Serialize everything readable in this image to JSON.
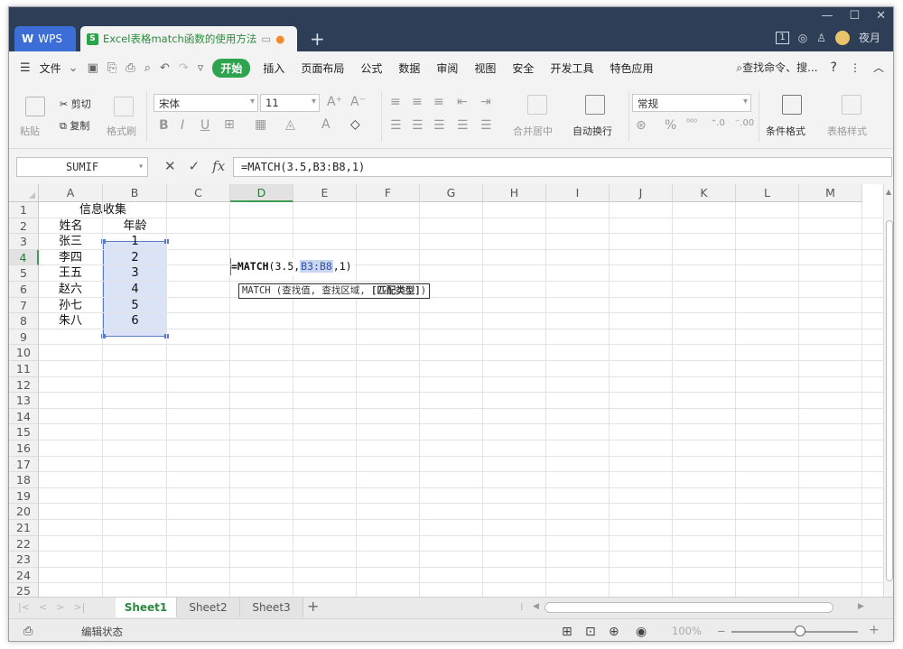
{
  "titlebar": {
    "app_tab": "WPS",
    "doc_tab": "Excel表格match函数的使用方法",
    "new_tab": "+",
    "badge": "1",
    "user": "夜月"
  },
  "menu": {
    "file": "文件",
    "start": "开始",
    "items": [
      "插入",
      "页面布局",
      "公式",
      "数据",
      "审阅",
      "视图",
      "安全",
      "开发工具",
      "特色应用"
    ],
    "search": "查找命令、搜...",
    "help": "?"
  },
  "ribbon": {
    "paste": "粘贴",
    "cut": "剪切",
    "copy": "复制",
    "format_painter": "格式刷",
    "font_name": "宋体",
    "font_size": "11",
    "merge": "合并居中",
    "wrap": "自动换行",
    "number_format": "常规",
    "cond_format": "条件格式",
    "table_style": "表格样式"
  },
  "formula_bar": {
    "name_box": "SUMIF",
    "formula": "=MATCH(3.5,B3:B8,1)"
  },
  "grid": {
    "columns": [
      "A",
      "B",
      "C",
      "D",
      "E",
      "F",
      "G",
      "H",
      "I",
      "J",
      "K",
      "L",
      "M"
    ],
    "rows": [
      "1",
      "2",
      "3",
      "4",
      "5",
      "6",
      "7",
      "8",
      "9",
      "10",
      "11",
      "12",
      "13",
      "14",
      "15",
      "16",
      "17",
      "18",
      "19",
      "20",
      "21",
      "22",
      "23",
      "24",
      "25"
    ],
    "title": "信息收集",
    "header_name": "姓名",
    "header_age": "年龄",
    "names": [
      "张三",
      "李四",
      "王五",
      "赵六",
      "孙七",
      "朱八"
    ],
    "ages": [
      "1",
      "2",
      "3",
      "4",
      "5",
      "6"
    ]
  },
  "editing": {
    "fn": "=MATCH",
    "arg1": "(3.5,",
    "ref": "B3:B8",
    "arg3": ",1)",
    "tooltip_fn": "MATCH (查找值, 查找区域, ",
    "tooltip_opt": "[匹配类型]",
    "tooltip_end": ")"
  },
  "sheets": [
    "Sheet1",
    "Sheet2",
    "Sheet3"
  ],
  "status": {
    "mode": "编辑状态",
    "zoom": "100%"
  }
}
